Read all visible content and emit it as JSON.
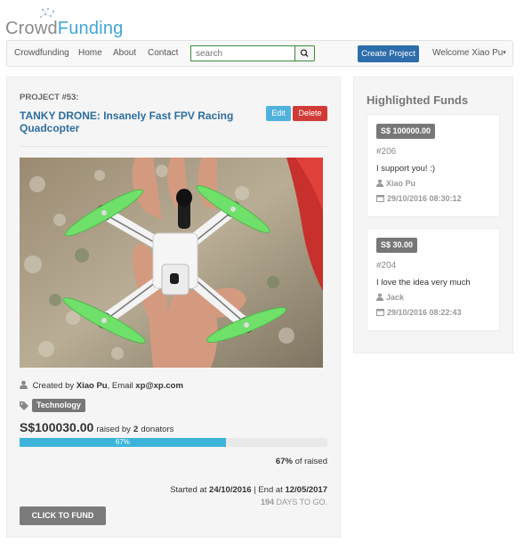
{
  "logo": {
    "part1": "Crowd",
    "part2": "Funding"
  },
  "nav": {
    "links": [
      "Crowdfunding",
      "Home",
      "About",
      "Contact"
    ],
    "search_placeholder": "search",
    "create_label": "Create Project",
    "welcome": "Welcome Xiao Pu"
  },
  "project": {
    "number": "PROJECT #53:",
    "title": "TANKY DRONE: Insanely Fast FPV Racing Quadcopter",
    "edit_label": "Edit",
    "delete_label": "Delete",
    "created_prefix": "Created by",
    "creator": "Xiao Pu",
    "email_prefix": ", Email",
    "email": "xp@xp.com",
    "tag": "Technology",
    "raised_amount": "S$100030.00",
    "raised_by": "raised by",
    "donators_count": "2",
    "donators_word": "donators",
    "progress_percent": 67,
    "progress_label": "67%",
    "pct_text": "67%",
    "pct_suffix": "of raised",
    "started_prefix": "Started at",
    "start_date": "24/10/2016",
    "end_prefix": "| End at",
    "end_date": "12/05/2017",
    "days_left": "194",
    "days_suffix": "DAYS TO GO.",
    "fund_label": "CLICK TO FUND"
  },
  "sidebar": {
    "title": "Highlighted Funds",
    "funds": [
      {
        "amount": "S$ 100000.00",
        "id": "#206",
        "message": "I support you! :)",
        "user": "Xiao Pu",
        "date": "29/10/2016 08:30:12"
      },
      {
        "amount": "S$ 30.00",
        "id": "#204",
        "message": "I love the idea very much",
        "user": "Jack",
        "date": "29/10/2016 08:22:43"
      }
    ]
  },
  "colors": {
    "brand_blue": "#41a6d8",
    "title_blue": "#2d6e9f",
    "create_button": "#2c6daa",
    "edit_button": "#50b2dc",
    "delete_button": "#d13b37",
    "progress_fill": "#3cb4d9",
    "search_border": "#3c8d3c",
    "drone_propeller": "#6fe06a"
  }
}
